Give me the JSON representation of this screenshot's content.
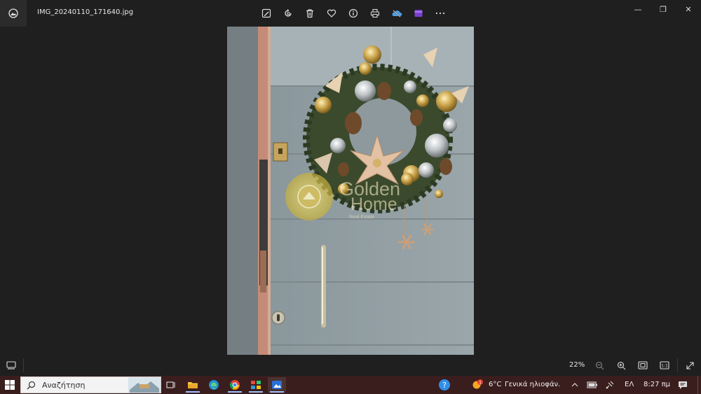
{
  "titlebar": {
    "filename": "IMG_20240110_171640.jpg",
    "app_icon": "photos-icon",
    "toolbar": [
      {
        "name": "edit-image-icon"
      },
      {
        "name": "rotate-icon"
      },
      {
        "name": "delete-icon"
      },
      {
        "name": "favorite-heart-icon"
      },
      {
        "name": "info-icon"
      },
      {
        "name": "print-icon"
      },
      {
        "name": "onedrive-icon"
      },
      {
        "name": "clipchamp-icon"
      },
      {
        "name": "more-icon"
      }
    ],
    "window_controls": {
      "minimize": "—",
      "restore": "❐",
      "close": "✕"
    }
  },
  "photo": {
    "watermark_line1": "Golden",
    "watermark_line2": "Home",
    "watermark_line3": "Real   Estate"
  },
  "bottombar": {
    "zoom": "22%"
  },
  "taskbar": {
    "search_placeholder": "Αναζήτηση",
    "weather_temp": "6°C",
    "weather_desc": "Γενικά ηλιοφάν.",
    "weather_badge": "1",
    "language": "ΕΛ",
    "time": "8:27 πμ"
  },
  "colors": {
    "window_bg": "#1f1f1f",
    "taskbar_bg": "#3a1d1d",
    "accent": "#9ec3ff"
  }
}
